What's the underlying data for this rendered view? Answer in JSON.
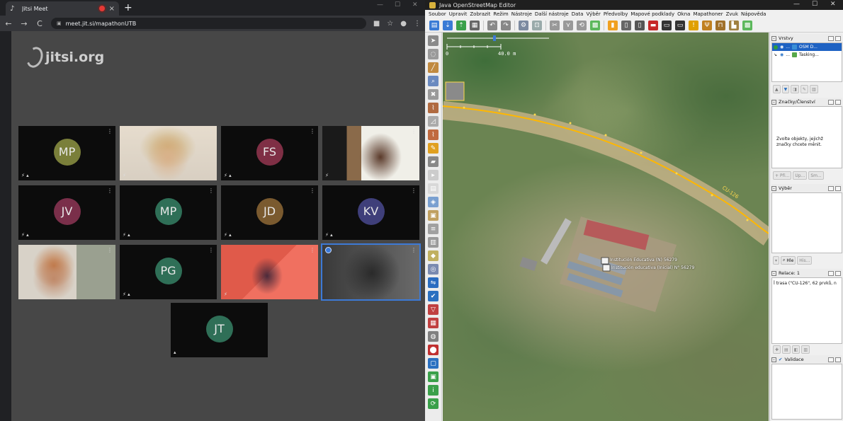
{
  "browser": {
    "tab_title": "Jitsi Meet",
    "tab_close": "×",
    "new_tab": "+",
    "url": "meet.jit.si/mapathonUTB",
    "win_min": "—",
    "win_max": "☐",
    "win_close": "✕",
    "back": "←",
    "forward": "→",
    "reload": "C",
    "lock": "🔒",
    "cam": "■",
    "star": "☆",
    "profile": "●",
    "more": "⋮"
  },
  "jitsi": {
    "logo_text": "jitsi.org",
    "participants": [
      {
        "initials": "MP",
        "color": "#7a7f3a",
        "type": "avatar",
        "status": "⚡ ▴"
      },
      {
        "initials": "",
        "type": "video",
        "status": "⚡"
      },
      {
        "initials": "FS",
        "color": "#7f2f45",
        "type": "avatar",
        "status": "⚡ ▴"
      },
      {
        "initials": "",
        "type": "video",
        "status": "⚡"
      },
      {
        "initials": "JV",
        "color": "#7a2f4a",
        "type": "avatar",
        "status": "⚡ ▴"
      },
      {
        "initials": "MP",
        "color": "#2f6f57",
        "type": "avatar",
        "status": "⚡ ▴"
      },
      {
        "initials": "JD",
        "color": "#7a5a2f",
        "type": "avatar",
        "status": "⚡ ▴"
      },
      {
        "initials": "KV",
        "color": "#3f3f7a",
        "type": "avatar",
        "status": "⚡ ▴"
      },
      {
        "initials": "",
        "type": "video",
        "status": ""
      },
      {
        "initials": "PG",
        "color": "#2f6f57",
        "type": "avatar",
        "status": "⚡ ▴"
      },
      {
        "initials": "",
        "type": "video",
        "status": "⚡"
      },
      {
        "initials": "",
        "type": "video",
        "status": ""
      },
      {
        "initials": "JT",
        "color": "#2f6f57",
        "type": "avatar",
        "status": "▴"
      }
    ],
    "tile_menu": "⋮"
  },
  "josm": {
    "title": "Java OpenStreetMap Editor",
    "menu": [
      "Soubor",
      "Upravit",
      "Zobrazit",
      "Režim",
      "Nástroje",
      "Další nástroje",
      "Data",
      "Výběr",
      "Předvolby",
      "Mapové podklady",
      "Okna",
      "Mapathoner",
      "Zvuk",
      "Nápověda"
    ],
    "scale_zero": "0",
    "scale_text": "40.0 m",
    "road_label": "CU-126",
    "poi_1": "Institución Educativa (N) 56279",
    "poi_2": "Institución educativa (Inicial) N° 56279",
    "layers_panel": {
      "title": "Vrstvy",
      "rows": [
        {
          "label": "OSM D...",
          "selected": true,
          "color": "#3a8fd6"
        },
        {
          "label": "Tasking...",
          "selected": false,
          "color": "#58a84a"
        }
      ],
      "row_dots": "..."
    },
    "tags_panel": {
      "title": "Značky/Členství",
      "message": "Zvolte objekty, jejichž značky chcete měnit.",
      "btn_add": "Při...",
      "btn_edit": "Up...",
      "btn_delete": "Sm..."
    },
    "selection_panel": {
      "title": "Výběr",
      "btn_search": "Hle",
      "btn_history": "His..."
    },
    "relations_panel": {
      "title": "Relace: 1",
      "row": "trasa (\"CU-126\", 62 prvků, n"
    },
    "validation_panel": {
      "title": "Validace"
    }
  }
}
